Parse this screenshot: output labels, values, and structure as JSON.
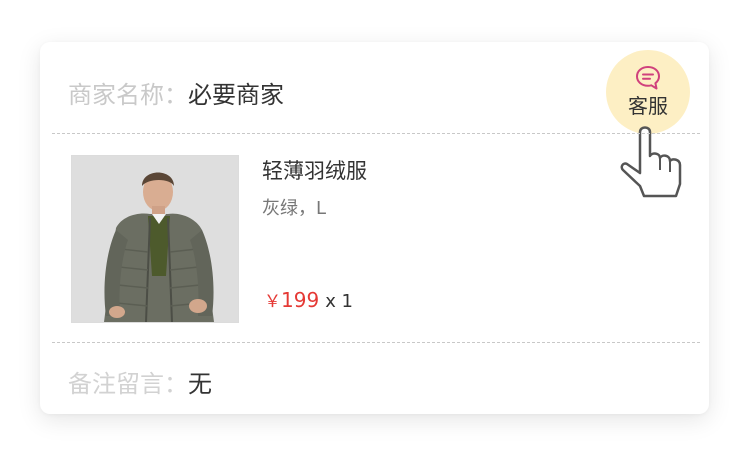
{
  "merchant": {
    "label": "商家名称：",
    "name": "必要商家"
  },
  "customer_service": {
    "label": "客服",
    "icon": "chat-bubble-icon",
    "badge_color": "#fdefc4",
    "icon_color": "#d0417c"
  },
  "pointer": {
    "icon": "hand-pointer-icon"
  },
  "product": {
    "image": "green-down-jacket-photo",
    "name": "轻薄羽绒服",
    "spec": "灰绿，L",
    "currency": "￥",
    "price": "199",
    "quantity": "x 1",
    "price_color": "#e53935"
  },
  "note": {
    "label": "备注留言：",
    "value": "无"
  }
}
